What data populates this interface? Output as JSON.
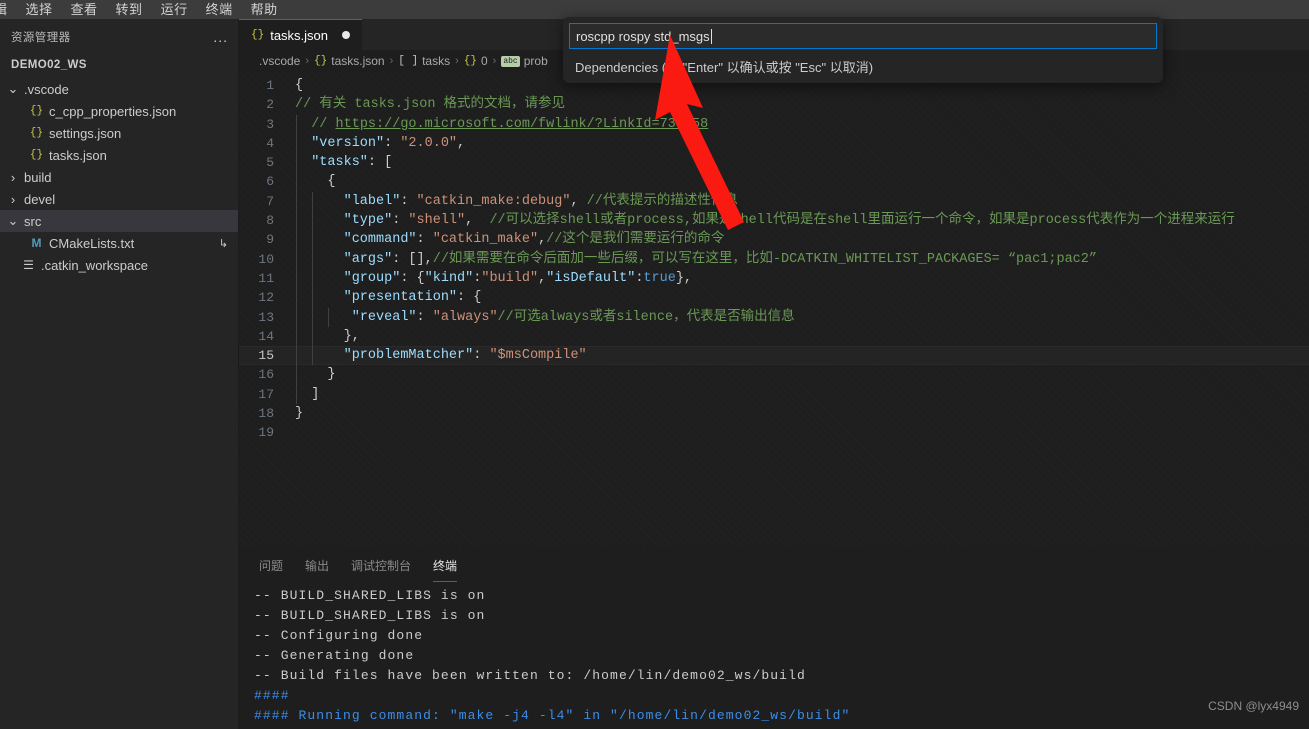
{
  "menubar": {
    "items": [
      "辑",
      "选择",
      "查看",
      "转到",
      "运行",
      "终端",
      "帮助"
    ]
  },
  "sidebar": {
    "title": "资源管理器",
    "more_label": "...",
    "root_folder": "DEMO02_WS",
    "items": [
      {
        "label": ".vscode",
        "icon": "chevron-down-icon",
        "chevron": "⌄",
        "file_icon": "",
        "kind": "folder",
        "selected": false,
        "indent": 0,
        "git": ""
      },
      {
        "label": "c_cpp_properties.json",
        "icon": "json-icon",
        "chevron": "",
        "file_icon": "{}",
        "kind": "json",
        "selected": false,
        "indent": 1,
        "git": ""
      },
      {
        "label": "settings.json",
        "icon": "json-icon",
        "chevron": "",
        "file_icon": "{}",
        "kind": "json",
        "selected": false,
        "indent": 1,
        "git": ""
      },
      {
        "label": "tasks.json",
        "icon": "json-icon",
        "chevron": "",
        "file_icon": "{}",
        "kind": "json",
        "selected": false,
        "indent": 1,
        "git": ""
      },
      {
        "label": "build",
        "icon": "chevron-right-icon",
        "chevron": "›",
        "file_icon": "",
        "kind": "folder",
        "selected": false,
        "indent": 0,
        "git": ""
      },
      {
        "label": "devel",
        "icon": "chevron-right-icon",
        "chevron": "›",
        "file_icon": "",
        "kind": "folder",
        "selected": false,
        "indent": 0,
        "git": ""
      },
      {
        "label": "src",
        "icon": "chevron-down-icon",
        "chevron": "⌄",
        "file_icon": "",
        "kind": "folder",
        "selected": true,
        "indent": 0,
        "git": ""
      },
      {
        "label": "CMakeLists.txt",
        "icon": "cmake-icon",
        "chevron": "",
        "file_icon": "M",
        "kind": "cmake",
        "selected": false,
        "indent": 1,
        "git": "↳"
      },
      {
        "label": ".catkin_workspace",
        "icon": "text-file-icon",
        "chevron": "",
        "file_icon": "☰",
        "kind": "plain",
        "selected": false,
        "indent": 0,
        "git": ""
      }
    ]
  },
  "editor": {
    "tab": {
      "label": "tasks.json",
      "icon": "{}",
      "dirty": true
    },
    "breadcrumb": [
      {
        "sym": "",
        "label": ".vscode",
        "symclass": "none"
      },
      {
        "sym": "{}",
        "label": "tasks.json",
        "symclass": "obj"
      },
      {
        "sym": "[ ]",
        "label": "tasks",
        "symclass": "arr"
      },
      {
        "sym": "{}",
        "label": "0",
        "symclass": "obj"
      },
      {
        "sym": "abc",
        "label": "prob",
        "symclass": "str"
      }
    ],
    "breadcrumb_separator": "›",
    "lines": [
      {
        "n": 1,
        "indent": 0,
        "active": false
      },
      {
        "n": 2,
        "indent": 0,
        "active": false
      },
      {
        "n": 3,
        "indent": 1,
        "active": false
      },
      {
        "n": 4,
        "indent": 1,
        "active": false
      },
      {
        "n": 5,
        "indent": 1,
        "active": false
      },
      {
        "n": 6,
        "indent": 1,
        "active": false
      },
      {
        "n": 7,
        "indent": 2,
        "active": false
      },
      {
        "n": 8,
        "indent": 2,
        "active": false
      },
      {
        "n": 9,
        "indent": 2,
        "active": false
      },
      {
        "n": 10,
        "indent": 2,
        "active": false
      },
      {
        "n": 11,
        "indent": 2,
        "active": false
      },
      {
        "n": 12,
        "indent": 2,
        "active": false
      },
      {
        "n": 13,
        "indent": 3,
        "active": false
      },
      {
        "n": 14,
        "indent": 2,
        "active": false
      },
      {
        "n": 15,
        "indent": 2,
        "active": true
      },
      {
        "n": 16,
        "indent": 1,
        "active": false
      },
      {
        "n": 17,
        "indent": 1,
        "active": false
      },
      {
        "n": 18,
        "indent": 0,
        "active": false
      },
      {
        "n": 19,
        "indent": 0,
        "active": false
      }
    ],
    "source_text": {
      "l1": "{",
      "l2_comment": "// 有关 tasks.json 格式的文档，请参见",
      "l3_comment_prefix": "// ",
      "l3_link": "https://go.microsoft.com/fwlink/?LinkId=733558",
      "l4_key": "\"version\"",
      "l4_val": "\"2.0.0\"",
      "l5_key": "\"tasks\"",
      "l6": "{",
      "l7_key": "\"label\"",
      "l7_val": "\"catkin_make:debug\"",
      "l7_comment": "//代表提示的描述性信息",
      "l8_key": "\"type\"",
      "l8_val": "\"shell\"",
      "l8_comment": "//可以选择shell或者process,如果是shell代码是在shell里面运行一个命令，如果是process代表作为一个进程来运行",
      "l9_key": "\"command\"",
      "l9_val": "\"catkin_make\"",
      "l9_comment": "//这个是我们需要运行的命令",
      "l10_key": "\"args\"",
      "l10_val": "[]",
      "l10_comment": "//如果需要在命令后面加一些后缀，可以写在这里，比如-DCATKIN_WHITELIST_PACKAGES= “pac1;pac2”",
      "l11_key": "\"group\"",
      "l11_kind_key": "\"kind\"",
      "l11_kind_val": "\"build\"",
      "l11_def_key": "\"isDefault\"",
      "l11_def_val": "true",
      "l12_key": "\"presentation\"",
      "l13_key": "\"reveal\"",
      "l13_val": "\"always\"",
      "l13_comment": "//可选always或者silence，代表是否输出信息",
      "l14": "},",
      "l15_key": "\"problemMatcher\"",
      "l15_val": "\"$msCompile\"",
      "l16": "}",
      "l17": "]",
      "l18": "}"
    }
  },
  "quick_input": {
    "value": "roscpp rospy std_msgs",
    "placeholder": "Dependencies",
    "description": "Dependencies (按 \"Enter\" 以确认或按 \"Esc\" 以取消)",
    "accent_color": "#0078d4"
  },
  "panel": {
    "tabs": [
      {
        "label": "问题",
        "active": false
      },
      {
        "label": "输出",
        "active": false
      },
      {
        "label": "调试控制台",
        "active": false
      },
      {
        "label": "终端",
        "active": true
      }
    ],
    "terminal_lines": [
      {
        "text": "-- BUILD_SHARED_LIBS is on",
        "kind": "normal"
      },
      {
        "text": "-- BUILD_SHARED_LIBS is on",
        "kind": "normal"
      },
      {
        "text": "-- Configuring done",
        "kind": "normal"
      },
      {
        "text": "-- Generating done",
        "kind": "normal"
      },
      {
        "text": "-- Build files have been written to: /home/lin/demo02_ws/build",
        "kind": "normal"
      },
      {
        "text": "####",
        "kind": "hash"
      },
      {
        "text": "#### Running command: \"make -j4 -l4\" in \"/home/lin/demo02_ws/build\"",
        "kind": "hash"
      }
    ]
  },
  "annotation": {
    "arrow_color": "#fb1a11"
  },
  "watermark": "CSDN @lyx4949"
}
